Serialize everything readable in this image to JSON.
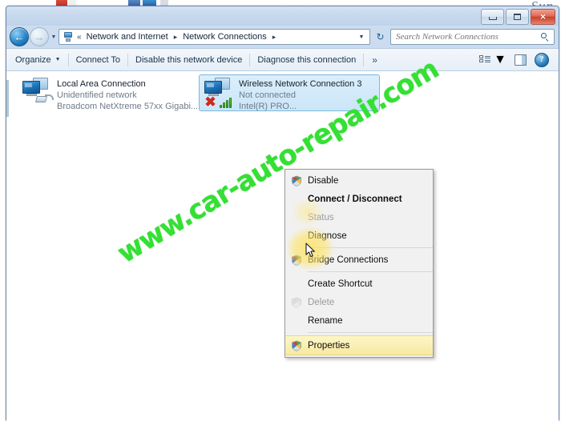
{
  "window": {
    "title": "",
    "buttons": {
      "minimize": "minimize",
      "maximize": "maximize",
      "close": "×"
    }
  },
  "address_bar": {
    "back_arrow": "←",
    "forward_arrow": "→",
    "recent_caret": "▼",
    "chevron_left": "«",
    "breadcrumbs": [
      {
        "label": "Network and Internet"
      },
      {
        "label": "Network Connections"
      }
    ],
    "separator": "▸",
    "dropdown_caret": "▼",
    "refresh_icon": "↻"
  },
  "search": {
    "placeholder": "Search Network Connections",
    "value": ""
  },
  "toolbar": {
    "items": [
      {
        "label": "Organize",
        "has_dropdown": true,
        "caret": "▼"
      },
      {
        "label": "Connect To",
        "has_dropdown": false
      },
      {
        "label": "Disable this network device",
        "has_dropdown": false
      },
      {
        "label": "Diagnose this connection",
        "has_dropdown": false
      }
    ],
    "overflow": "»",
    "views_caret": "▼",
    "help_label": "?"
  },
  "connections": [
    {
      "name": "Local Area Connection",
      "status": "Unidentified network",
      "device": "Broadcom NetXtreme 57xx Gigabi...",
      "selected": false,
      "has_wifi_bars": false,
      "has_red_x": false,
      "has_cable": true
    },
    {
      "name": "Wireless Network Connection 3",
      "status": "Not connected",
      "device": "Intel(R) PRO...",
      "selected": true,
      "has_wifi_bars": true,
      "has_red_x": true,
      "has_cable": false
    }
  ],
  "context_menu": {
    "items": [
      {
        "label": "Disable",
        "shield": true,
        "disabled": false,
        "bold": false,
        "highlight": false,
        "separator_after": false
      },
      {
        "label": "Connect / Disconnect",
        "shield": false,
        "disabled": false,
        "bold": true,
        "highlight": false,
        "separator_after": false
      },
      {
        "label": "Status",
        "shield": false,
        "disabled": true,
        "bold": false,
        "highlight": false,
        "separator_after": false
      },
      {
        "label": "Diagnose",
        "shield": false,
        "disabled": false,
        "bold": false,
        "highlight": false,
        "separator_after": true
      },
      {
        "label": "Bridge Connections",
        "shield": true,
        "disabled": false,
        "bold": false,
        "highlight": false,
        "separator_after": true
      },
      {
        "label": "Create Shortcut",
        "shield": false,
        "disabled": false,
        "bold": false,
        "highlight": false,
        "separator_after": false
      },
      {
        "label": "Delete",
        "shield": true,
        "disabled": true,
        "bold": false,
        "highlight": false,
        "separator_after": false
      },
      {
        "label": "Rename",
        "shield": false,
        "disabled": false,
        "bold": false,
        "highlight": false,
        "separator_after": true
      },
      {
        "label": "Properties",
        "shield": true,
        "disabled": false,
        "bold": false,
        "highlight": true,
        "separator_after": false
      }
    ]
  },
  "watermark": {
    "text": "www.car-auto-repair.com",
    "color": "#33e033"
  },
  "desktop": {
    "ghost_text": "Sun"
  },
  "colors": {
    "window_frame": "#6c87a8",
    "titlebar": "#c6d8ee",
    "selection_fill": "#cbe6f8",
    "selection_border": "#7ab8e0",
    "menu_highlight": "#f7e9a0",
    "accent_green": "#33e033",
    "close_button": "#c9412c"
  }
}
